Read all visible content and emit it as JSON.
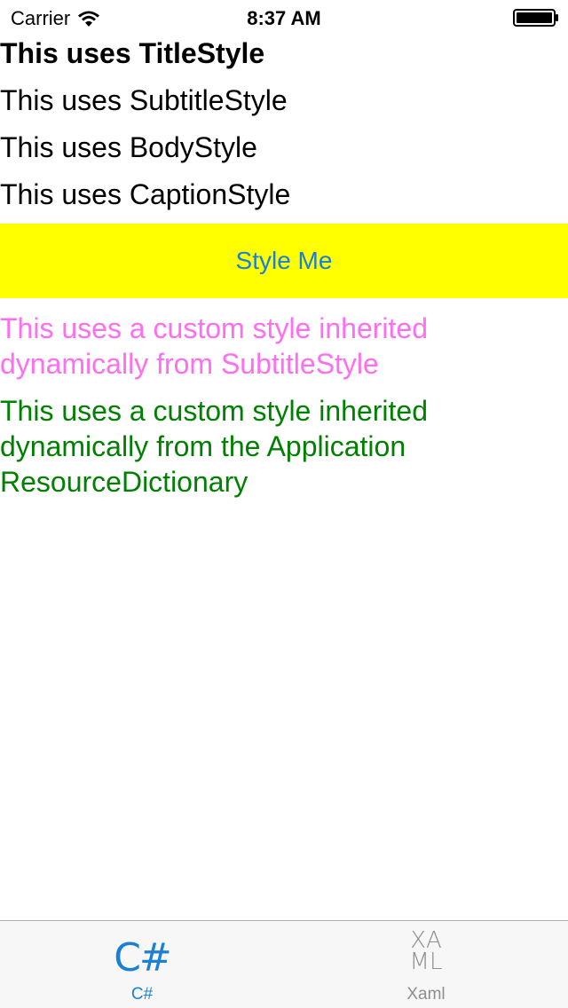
{
  "status_bar": {
    "carrier": "Carrier",
    "time": "8:37 AM"
  },
  "labels": {
    "title": "This uses TitleStyle",
    "subtitle": "This uses SubtitleStyle",
    "body": "This uses BodyStyle",
    "caption": "This uses CaptionStyle"
  },
  "style_button": {
    "label": "Style Me",
    "background": "#ffff00",
    "text_color": "#1a7fd6"
  },
  "custom_labels": {
    "subtitle_inherited": "This uses a custom style inherited dynamically from SubtitleStyle",
    "app_resource_inherited": "This uses a custom style inherited dynamically from the Application ResourceDictionary"
  },
  "colors": {
    "pink": "#ff6ef0",
    "green": "#008000",
    "accent": "#1a7fd6",
    "inactive": "#8f8f8f"
  },
  "tabs": [
    {
      "icon_text": "C#",
      "label": "C#",
      "icon": "csharp-icon",
      "active": true
    },
    {
      "icon_text_line1": "XA",
      "icon_text_line2": "ML",
      "label": "Xaml",
      "icon": "xaml-icon",
      "active": false
    }
  ]
}
